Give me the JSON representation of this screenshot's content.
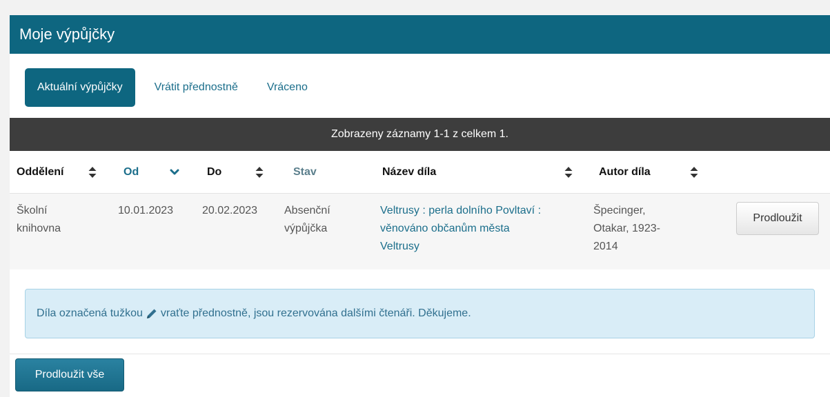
{
  "header": {
    "title": "Moje výpůjčky"
  },
  "tabs": [
    {
      "label": "Aktuální výpůjčky",
      "active": true
    },
    {
      "label": "Vrátit přednostně",
      "active": false
    },
    {
      "label": "Vráceno",
      "active": false
    }
  ],
  "records_bar": {
    "text": "Zobrazeny záznamy 1-1 z celkem 1."
  },
  "table": {
    "columns": [
      {
        "label": "Oddělení",
        "sort": "both"
      },
      {
        "label": "Od",
        "sort": "desc"
      },
      {
        "label": "Do",
        "sort": "both"
      },
      {
        "label": "Stav",
        "sort": "none"
      },
      {
        "label": "Název díla",
        "sort": "both"
      },
      {
        "label": "Autor díla",
        "sort": "both"
      }
    ],
    "rows": [
      {
        "department_line1": "Školní",
        "department_line2": "knihovna",
        "from": "10.01.2023",
        "to": "20.02.2023",
        "status_line1": "Absenční",
        "status_line2": "výpůjčka",
        "title_line1": "Veltrusy : perla dolního Povltaví :",
        "title_line2": "věnováno občanům města",
        "title_line3": "Veltrusy",
        "author_line1": "Špecinger,",
        "author_line2": "Otakar, 1923-",
        "author_line3": "2014",
        "renew_label": "Prodloužit"
      }
    ]
  },
  "info": {
    "text_before": "Díla označená tužkou",
    "icon": "pencil-icon",
    "text_after": "vraťte přednostně, jsou rezervována dalšími čtenáři. Děkujeme."
  },
  "footer": {
    "renew_all_label": "Prodloužit vše"
  },
  "colors": {
    "primary": "#0e6680",
    "link": "#1b6e8b",
    "dark_bar": "#3d3d3d",
    "info_bg": "#d9edf7",
    "info_text": "#31708f"
  }
}
